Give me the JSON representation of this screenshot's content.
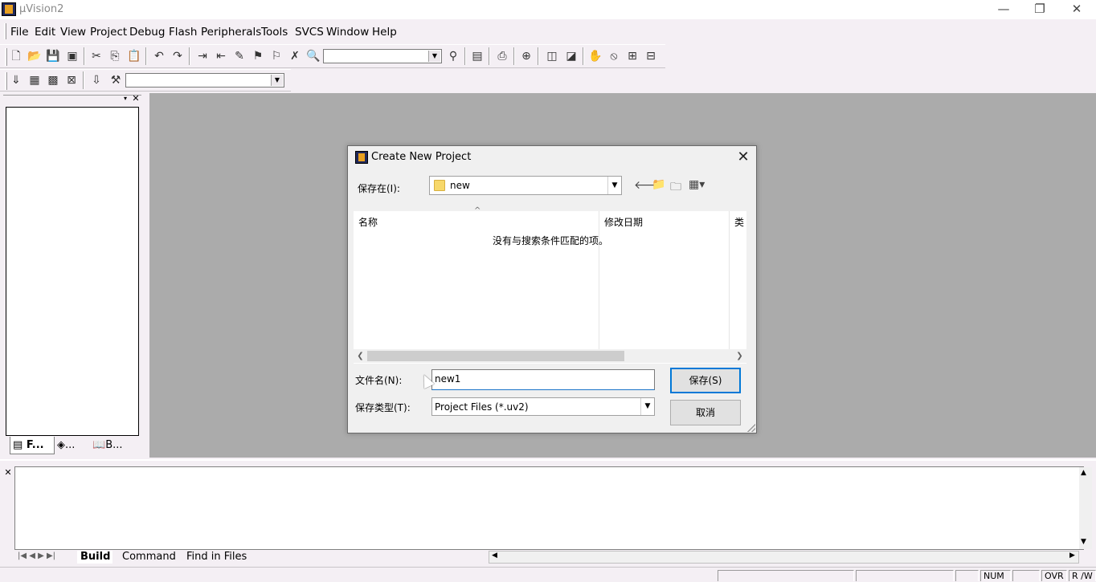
{
  "window": {
    "title": "µVision2",
    "minimize": "—",
    "restore": "❐",
    "close": "✕"
  },
  "menu": [
    "File",
    "Edit",
    "View",
    "Project",
    "Debug",
    "Flash",
    "Peripherals",
    "Tools",
    "SVCS",
    "Window",
    "Help"
  ],
  "left_panel": {
    "tabs": [
      "F...",
      "...",
      "B..."
    ]
  },
  "output": {
    "tabs": [
      "Build",
      "Command",
      "Find in Files"
    ]
  },
  "status": {
    "num": "NUM",
    "ovr": "OVR",
    "rw": "R /W"
  },
  "dialog": {
    "title": "Create New Project",
    "save_in_label": "保存在(I):",
    "folder": "new",
    "columns": [
      "名称",
      "修改日期",
      "类"
    ],
    "empty_message": "没有与搜索条件匹配的项。",
    "filename_label": "文件名(N):",
    "filename_value": "new1",
    "filetype_label": "保存类型(T):",
    "filetype_value": "Project Files (*.uv2)",
    "save_button": "保存(S)",
    "cancel_button": "取消"
  }
}
